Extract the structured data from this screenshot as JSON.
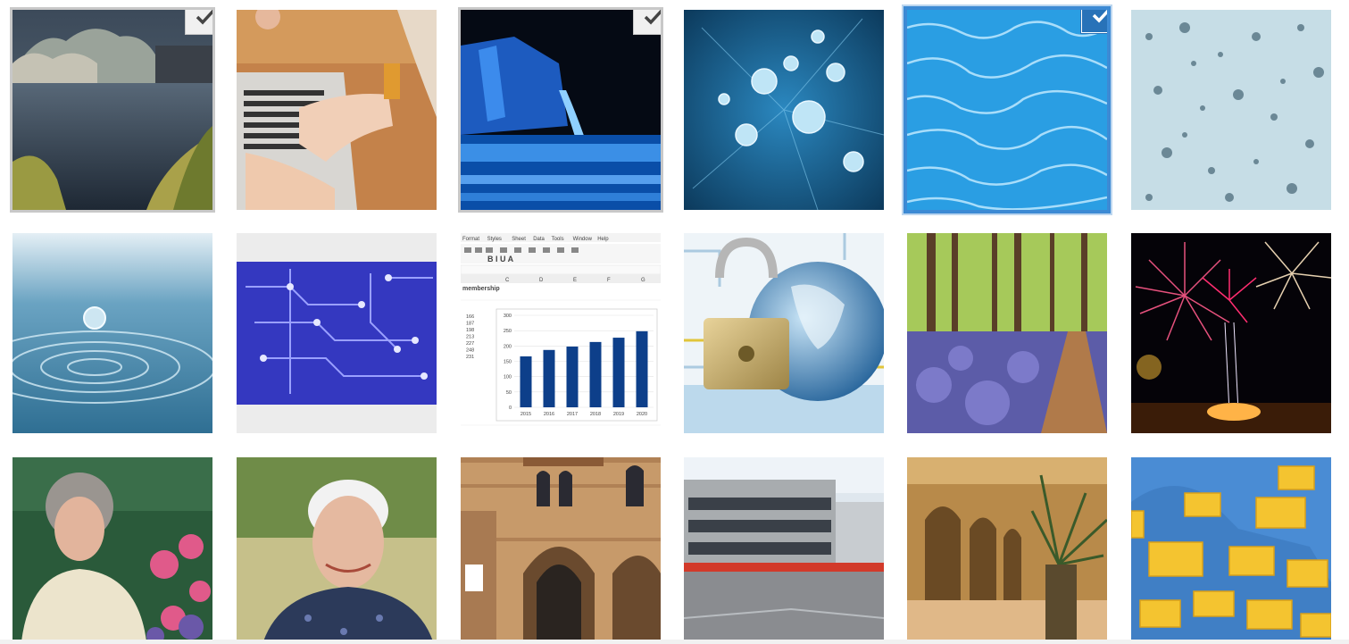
{
  "media_grid": {
    "items": [
      {
        "id": "lake",
        "checked": true,
        "selected": false
      },
      {
        "id": "laptop",
        "checked": false,
        "selected": false
      },
      {
        "id": "water-bottle",
        "checked": true,
        "selected": false
      },
      {
        "id": "dew-drops",
        "checked": false,
        "selected": false
      },
      {
        "id": "pool-water",
        "checked": true,
        "selected": true
      },
      {
        "id": "raindrops",
        "checked": false,
        "selected": false
      },
      {
        "id": "water-drop-ripple",
        "checked": false,
        "selected": false
      },
      {
        "id": "circuit-board",
        "checked": false,
        "selected": false
      },
      {
        "id": "spreadsheet-chart",
        "checked": false,
        "selected": false
      },
      {
        "id": "padlock-globe",
        "checked": false,
        "selected": false
      },
      {
        "id": "bluebell-forest",
        "checked": false,
        "selected": false
      },
      {
        "id": "fireworks",
        "checked": false,
        "selected": false
      },
      {
        "id": "elderly-woman-flowers",
        "checked": false,
        "selected": false
      },
      {
        "id": "elderly-woman-smiling",
        "checked": false,
        "selected": false
      },
      {
        "id": "moorish-building",
        "checked": false,
        "selected": false
      },
      {
        "id": "modern-building",
        "checked": false,
        "selected": false
      },
      {
        "id": "palace-corridor",
        "checked": false,
        "selected": false
      },
      {
        "id": "envelopes",
        "checked": false,
        "selected": false
      }
    ]
  },
  "spreadsheet_thumb": {
    "menu": [
      "Format",
      "Styles",
      "Sheet",
      "Data",
      "Tools",
      "Window",
      "Help"
    ],
    "sheet_title": "membership",
    "column_letters": [
      "C",
      "D",
      "E",
      "F",
      "G"
    ],
    "cell_values": [
      "166",
      "187",
      "198",
      "213",
      "227",
      "248",
      "231"
    ],
    "chart_data": {
      "type": "bar",
      "categories": [
        "2015",
        "2016",
        "2017",
        "2018",
        "2019",
        "2020"
      ],
      "values": [
        166,
        187,
        198,
        213,
        227,
        248
      ],
      "ylim": [
        0,
        300
      ],
      "y_ticks": [
        "300",
        "250",
        "200",
        "150",
        "100",
        "50",
        "0"
      ],
      "bar_color": "#0d3f8a"
    }
  },
  "icons": {
    "check": "checkmark-icon"
  },
  "colors": {
    "selection_blue": "#2872b8",
    "checkbox_gray": "#f0f0f0"
  }
}
